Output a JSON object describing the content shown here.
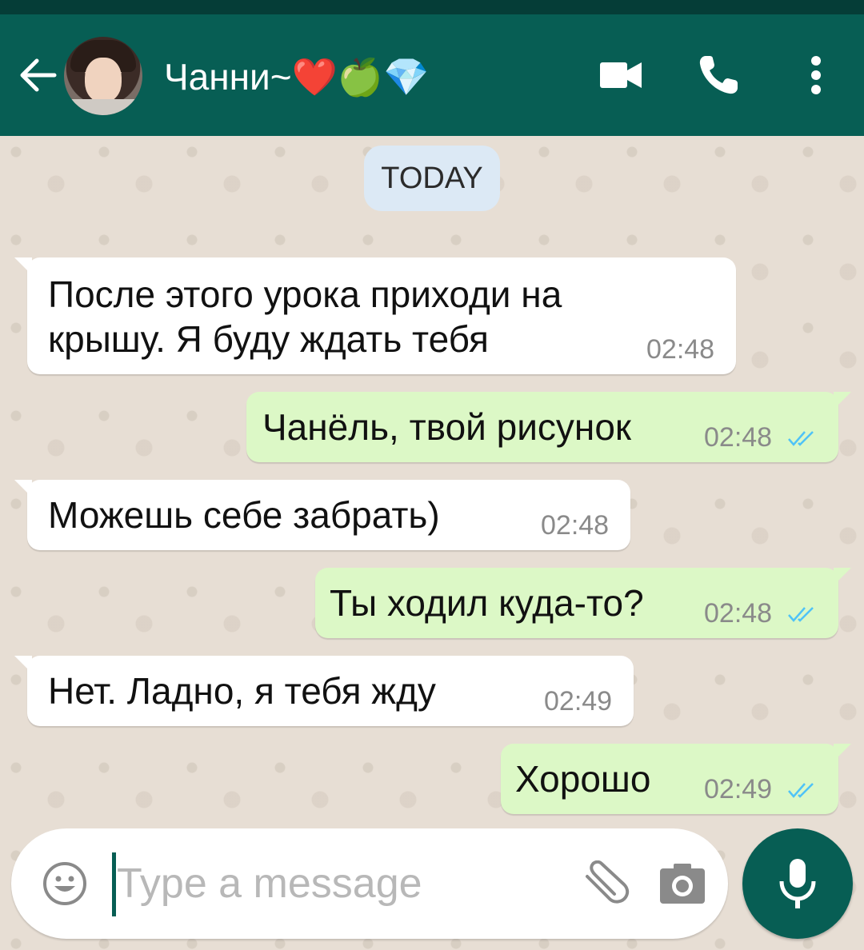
{
  "header": {
    "contact_name": "Чанни~",
    "contact_emojis": "❤️🍏💎",
    "avatar_alt": "contact photo"
  },
  "icons": {
    "back": "back-arrow-icon",
    "video": "video-call-icon",
    "call": "phone-call-icon",
    "menu": "more-options-icon"
  },
  "chat": {
    "date_label": "TODAY",
    "messages": [
      {
        "direction": "in",
        "line1": "После этого урока приходи на",
        "line2": "крышу. Я буду ждать тебя",
        "time": "02:48"
      },
      {
        "direction": "out",
        "text": "Чанёль, твой рисунок",
        "time": "02:48",
        "status": "read"
      },
      {
        "direction": "in",
        "text": "Можешь себе забрать)",
        "time": "02:48"
      },
      {
        "direction": "out",
        "text": "Ты ходил куда-то?",
        "time": "02:48",
        "status": "read"
      },
      {
        "direction": "in",
        "text": "Нет. Ладно, я тебя жду",
        "time": "02:49"
      },
      {
        "direction": "out",
        "text": "Хорошо",
        "time": "02:49",
        "status": "read"
      }
    ]
  },
  "composer": {
    "placeholder": "Type a message"
  },
  "colors": {
    "header": "#075e54",
    "outgoing_bubble": "#dcf8c6",
    "incoming_bubble": "#ffffff",
    "read_ticks": "#4fc3f7"
  }
}
